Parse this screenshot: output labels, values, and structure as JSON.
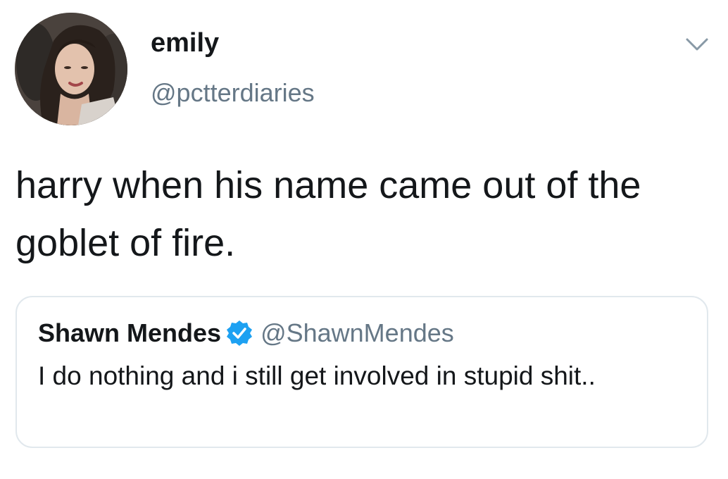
{
  "tweet": {
    "display_name": "emily",
    "handle": "@pctterdiaries",
    "text": "harry when his name came out of the goblet of fire."
  },
  "quoted_tweet": {
    "display_name": "Shawn Mendes",
    "handle": "@ShawnMendes",
    "text": "I do nothing and i still get involved in stupid shit..",
    "verified_icon": "verified-badge-icon"
  },
  "icons": {
    "menu": "chevron-down-icon"
  },
  "colors": {
    "text_primary": "#14171a",
    "text_secondary": "#657786",
    "verified_blue": "#1da1f2",
    "card_border": "#e1e8ed"
  }
}
